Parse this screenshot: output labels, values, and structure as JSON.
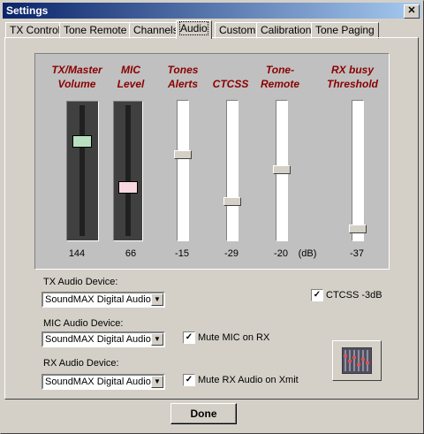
{
  "window": {
    "title": "Settings"
  },
  "tabs": [
    "TX Control",
    "Tone Remote",
    "Channels",
    "Audio",
    "Custom",
    "Calibration",
    "Tone Paging"
  ],
  "active_tab": "Audio",
  "sliders": [
    {
      "label_line1": "TX/Master",
      "label_line2": "Volume",
      "value": "144",
      "thumb_color": "#b8e0c0"
    },
    {
      "label_line1": "MIC",
      "label_line2": "Level",
      "value": "66",
      "thumb_color": "#f8d8e0"
    },
    {
      "label_line1": "Tones",
      "label_line2": "Alerts",
      "value": "-15"
    },
    {
      "label_line1": "CTCSS",
      "label_line2": "",
      "value": "-29"
    },
    {
      "label_line1": "Tone-",
      "label_line2": "Remote",
      "value": "-20"
    },
    {
      "label_line1": "RX busy",
      "label_line2": "Threshold",
      "value": "-37"
    }
  ],
  "db_unit": "(dB)",
  "devices": {
    "tx_label": "TX Audio Device:",
    "tx_value": "SoundMAX Digital Audio",
    "mic_label": "MIC Audio Device:",
    "mic_value": "SoundMAX Digital Audio",
    "rx_label": "RX Audio Device:",
    "rx_value": "SoundMAX Digital Audio"
  },
  "checkboxes": {
    "ctcss": {
      "label": "CTCSS -3dB",
      "checked": true
    },
    "mute_mic": {
      "label": "Mute MIC on RX",
      "checked": true
    },
    "mute_rx": {
      "label": "Mute RX Audio on Xmit",
      "checked": true
    }
  },
  "buttons": {
    "done": "Done",
    "close": "✕"
  },
  "icons": {
    "mixer": "mixer-icon"
  }
}
